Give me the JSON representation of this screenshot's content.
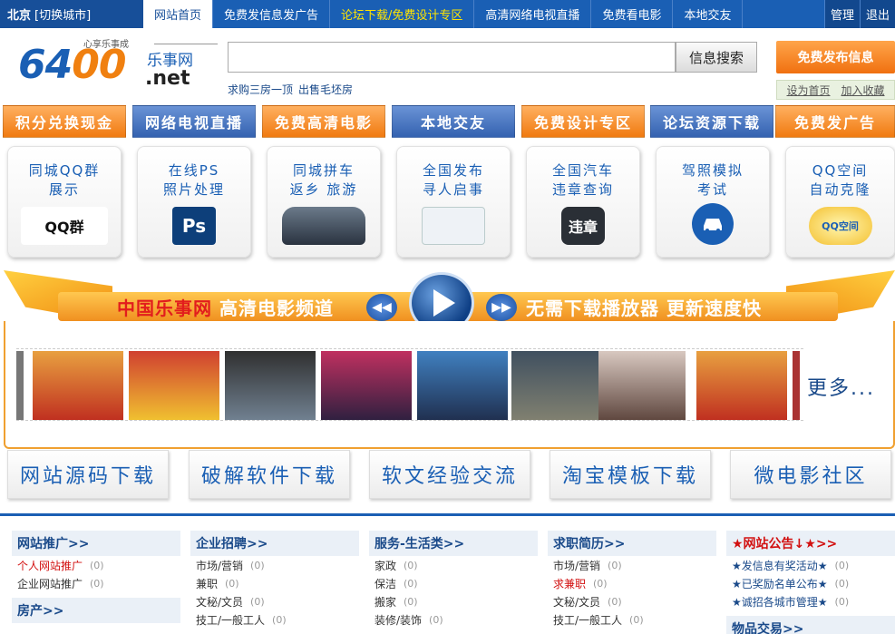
{
  "topnav": {
    "city": "北京",
    "switch_city": "[切换城市]",
    "items": [
      "网站首页",
      "免费发信息发广告",
      "论坛下载/免费设计专区",
      "高清网络电视直播",
      "免费看电影",
      "本地交友"
    ],
    "manage": "管理",
    "logout": "退出"
  },
  "logo": {
    "slogan": "心享乐事成",
    "num_a": "64",
    "num_b": "00",
    "cn": "乐事网",
    "net": ".net"
  },
  "search": {
    "placeholder": "",
    "button": "信息搜索",
    "links": [
      "求购三房一顶",
      "出售毛坯房"
    ]
  },
  "publish": {
    "label": "免费发布信息",
    "set_home": "设为首页",
    "add_fav": "加入收藏"
  },
  "btnrow": [
    "积分兑换现金",
    "网络电视直播",
    "免费高清电影",
    "本地交友",
    "免费设计专区",
    "论坛资源下载",
    "免费发广告"
  ],
  "cards": [
    {
      "t1": "同城QQ群",
      "t2": "展示",
      "icon": "QQ群"
    },
    {
      "t1": "在线PS",
      "t2": "照片处理",
      "icon": "Ps"
    },
    {
      "t1": "同城拼车",
      "t2": "返乡 旅游",
      "icon": "car"
    },
    {
      "t1": "全国发布",
      "t2": "寻人启事",
      "icon": "doc"
    },
    {
      "t1": "全国汽车",
      "t2": "违章查询",
      "icon": "违章"
    },
    {
      "t1": "驾照模拟",
      "t2": "考试",
      "icon": "car-circle"
    },
    {
      "t1": "QQ空间",
      "t2": "自动克隆",
      "icon": "QQ空间"
    }
  ],
  "banner": {
    "left_red": "中国乐事网",
    "left_white": "高清电影频道",
    "right": "无需下载播放器 更新速度快"
  },
  "strip": {
    "more": "更多..."
  },
  "resources": [
    "网站源码下载",
    "破解软件下载",
    "软文经验交流",
    "淘宝模板下载",
    "微电影社区"
  ],
  "categories": [
    {
      "head": "网站推广>>",
      "rows": [
        {
          "label": "个人网站推广",
          "count": "(0)",
          "red": true
        },
        {
          "label": "企业网站推广",
          "count": "(0)"
        }
      ],
      "head2": "房产>>"
    },
    {
      "head": "企业招聘>>",
      "rows": [
        {
          "label": "市场/营销",
          "count": "(0)"
        },
        {
          "label": "兼职",
          "count": "(0)"
        },
        {
          "label": "文秘/文员",
          "count": "(0)"
        },
        {
          "label": "技工/一般工人",
          "count": "(0)"
        }
      ]
    },
    {
      "head": "服务-生活类>>",
      "rows": [
        {
          "label": "家政",
          "count": "(0)"
        },
        {
          "label": "保洁",
          "count": "(0)"
        },
        {
          "label": "搬家",
          "count": "(0)"
        },
        {
          "label": "装修/装饰",
          "count": "(0)"
        }
      ]
    },
    {
      "head": "求职简历>>",
      "rows": [
        {
          "label": "市场/营销",
          "count": "(0)"
        },
        {
          "label": "求兼职",
          "count": "(0)",
          "red": true
        },
        {
          "label": "文秘/文员",
          "count": "(0)"
        },
        {
          "label": "技工/一般工人",
          "count": "(0)"
        }
      ]
    },
    {
      "head": "★网站公告↓★>>",
      "red": true,
      "rows": [
        {
          "label": "★发信息有奖活动★",
          "count": "(0)",
          "blue": true
        },
        {
          "label": "★已奖励名单公布★",
          "count": "(0)",
          "blue": true
        },
        {
          "label": "★诚招各城市管理★",
          "count": "(0)",
          "blue": true
        }
      ],
      "head2": "物品交易>>"
    }
  ]
}
